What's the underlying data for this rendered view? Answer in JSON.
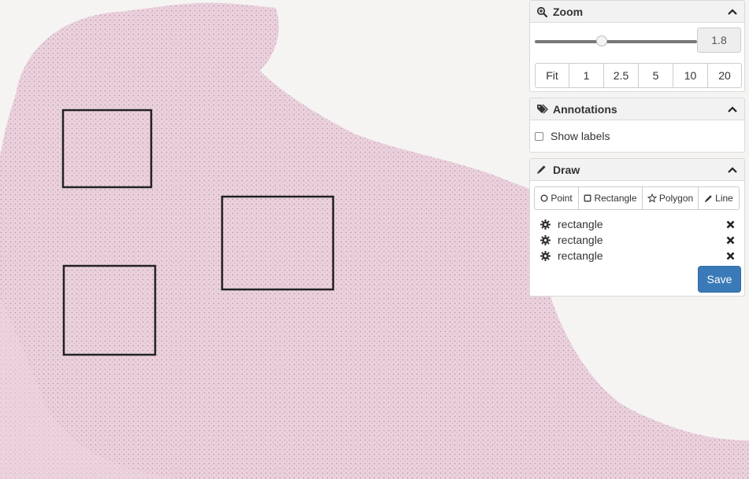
{
  "zoom": {
    "title": "Zoom",
    "icon": "zoom-in-icon",
    "value": "1.8",
    "slider_level": 1.8,
    "presets": [
      "Fit",
      "1",
      "2.5",
      "5",
      "10",
      "20"
    ]
  },
  "annotations": {
    "title": "Annotations",
    "icon": "tags-icon",
    "show_labels": "Show labels",
    "show_labels_checked": false
  },
  "draw": {
    "title": "Draw",
    "icon": "pencil-icon",
    "tools": [
      {
        "label": "Point",
        "icon": "circle-icon"
      },
      {
        "label": "Rectangle",
        "icon": "square-icon"
      },
      {
        "label": "Polygon",
        "icon": "star-icon"
      },
      {
        "label": "Line",
        "icon": "pencil-icon"
      }
    ],
    "items": [
      {
        "name": "rectangle"
      },
      {
        "name": "rectangle"
      },
      {
        "name": "rectangle"
      }
    ],
    "save_label": "Save"
  },
  "colors": {
    "accent": "#3a7ab8",
    "tissue": "#e8c9d8",
    "annotation_stroke": "#222222"
  }
}
